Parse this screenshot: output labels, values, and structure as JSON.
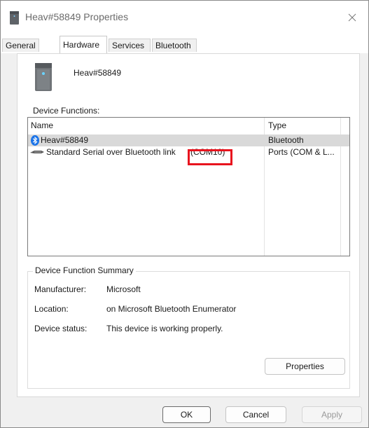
{
  "window": {
    "title": "Heav#58849 Properties",
    "close_icon": "close-icon"
  },
  "tabs": [
    {
      "label": "General",
      "active": false
    },
    {
      "label": "Hardware",
      "active": true
    },
    {
      "label": "Services",
      "active": false
    },
    {
      "label": "Bluetooth",
      "active": false
    }
  ],
  "device": {
    "name": "Heav#58849",
    "icon": "tower-device-icon"
  },
  "device_functions": {
    "label": "Device Functions:",
    "columns": {
      "name": "Name",
      "type": "Type"
    },
    "rows": [
      {
        "name": "Heav#58849",
        "type": "Bluetooth",
        "icon": "bluetooth-icon",
        "selected": true
      },
      {
        "name": "Standard Serial over Bluetooth link",
        "port": "(COM10)",
        "type": "Ports (COM & L...",
        "icon": "serial-cable-icon",
        "selected": false
      }
    ]
  },
  "summary": {
    "label": "Device Function Summary",
    "manufacturer_label": "Manufacturer:",
    "manufacturer_value": "Microsoft",
    "location_label": "Location:",
    "location_value": "on Microsoft Bluetooth Enumerator",
    "status_label": "Device status:",
    "status_value": "This device is working properly.",
    "properties_button": "Properties"
  },
  "footer": {
    "ok": "OK",
    "cancel": "Cancel",
    "apply": "Apply"
  },
  "colors": {
    "highlight": "#e8141e",
    "bluetooth": "#1a73e8",
    "selected_row": "#d9d9d9"
  }
}
